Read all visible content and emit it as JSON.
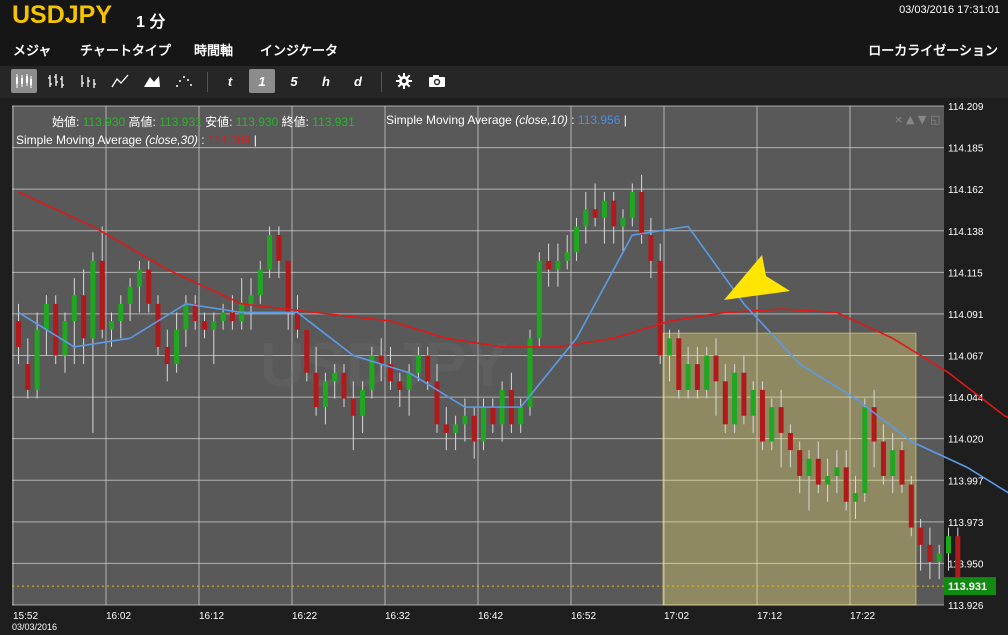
{
  "header": {
    "symbol": "USDJPY",
    "interval": "1 分",
    "datetime": "03/03/2016 17:31:01"
  },
  "menu": {
    "items": [
      "メジャ",
      "チャートタイプ",
      "時間軸",
      "インジケータ"
    ],
    "localization": "ローカライゼーション"
  },
  "toolbar": {
    "chart_types": [
      "candlestick-icon",
      "ohlc-bar-icon",
      "hlc-bar-icon",
      "line-icon",
      "mountain-icon",
      "dots-icon"
    ],
    "periods": [
      "t",
      "1",
      "5",
      "h",
      "d"
    ],
    "active_period": "1",
    "tools": [
      "gear-icon",
      "camera-icon"
    ]
  },
  "info": {
    "open_label": "始値:",
    "open": "113.930",
    "high_label": "高値:",
    "high": "113.931",
    "low_label": "安値:",
    "low": "113.930",
    "close_label": "終値:",
    "close": "113.931",
    "sma10_name": "Simple Moving Average",
    "sma10_params": "(close,10)",
    "sma10_value": "113.956",
    "sma30_name": "Simple Moving Average",
    "sma30_params": "(close,30)",
    "sma30_value": "114.009"
  },
  "colors": {
    "up": "#1fa81f",
    "down": "#b01a1a",
    "sma10": "#5b9be6",
    "sma30": "#e01818",
    "highlight": "#fff07a",
    "grid": "#cfcfcf",
    "background": "#595959",
    "arrow": "#ffe500"
  },
  "chart_data": {
    "type": "candlestick",
    "ylim": [
      113.92,
      114.21
    ],
    "y_ticks": [
      "114.209",
      "114.185",
      "114.162",
      "114.138",
      "114.115",
      "114.091",
      "114.067",
      "114.044",
      "114.020",
      "113.997",
      "113.973",
      "113.950",
      "113.926"
    ],
    "x_ticks": [
      "15:52",
      "16:02",
      "16:12",
      "16:22",
      "16:32",
      "16:42",
      "16:52",
      "17:02",
      "17:12",
      "17:22"
    ],
    "x_date": "03/03/2016",
    "last_price": "113.931",
    "start_time": "15:52",
    "candles": [
      [
        114.085,
        114.095,
        114.06,
        114.07
      ],
      [
        114.06,
        114.075,
        114.04,
        114.045
      ],
      [
        114.045,
        114.09,
        114.04,
        114.08
      ],
      [
        114.08,
        114.1,
        114.065,
        114.095
      ],
      [
        114.095,
        114.1,
        114.06,
        114.065
      ],
      [
        114.065,
        114.09,
        114.055,
        114.085
      ],
      [
        114.085,
        114.11,
        114.06,
        114.1
      ],
      [
        114.1,
        114.115,
        114.06,
        114.075
      ],
      [
        114.075,
        114.125,
        114.02,
        114.12
      ],
      [
        114.12,
        114.14,
        114.075,
        114.08
      ],
      [
        114.08,
        114.09,
        114.07,
        114.085
      ],
      [
        114.085,
        114.1,
        114.075,
        114.095
      ],
      [
        114.095,
        114.11,
        114.085,
        114.105
      ],
      [
        114.105,
        114.12,
        114.09,
        114.115
      ],
      [
        114.115,
        114.12,
        114.09,
        114.095
      ],
      [
        114.095,
        114.1,
        114.065,
        114.07
      ],
      [
        114.07,
        114.08,
        114.05,
        114.06
      ],
      [
        114.06,
        114.09,
        114.055,
        114.08
      ],
      [
        114.08,
        114.1,
        114.07,
        114.095
      ],
      [
        114.095,
        114.1,
        114.08,
        114.085
      ],
      [
        114.085,
        114.09,
        114.075,
        114.08
      ],
      [
        114.08,
        114.09,
        114.06,
        114.085
      ],
      [
        114.085,
        114.095,
        114.08,
        114.09
      ],
      [
        114.09,
        114.1,
        114.08,
        114.085
      ],
      [
        114.085,
        114.11,
        114.08,
        114.095
      ],
      [
        114.095,
        114.11,
        114.08,
        114.1
      ],
      [
        114.1,
        114.12,
        114.095,
        114.115
      ],
      [
        114.115,
        114.14,
        114.11,
        114.135
      ],
      [
        114.135,
        114.14,
        114.11,
        114.12
      ],
      [
        114.12,
        114.12,
        114.08,
        114.09
      ],
      [
        114.09,
        114.1,
        114.075,
        114.08
      ],
      [
        114.08,
        114.08,
        114.05,
        114.055
      ],
      [
        114.055,
        114.07,
        114.03,
        114.035
      ],
      [
        114.035,
        114.055,
        114.025,
        114.05
      ],
      [
        114.05,
        114.06,
        114.04,
        114.055
      ],
      [
        114.055,
        114.06,
        114.035,
        114.04
      ],
      [
        114.04,
        114.05,
        114.01,
        114.03
      ],
      [
        114.03,
        114.05,
        114.02,
        114.045
      ],
      [
        114.045,
        114.07,
        114.04,
        114.065
      ],
      [
        114.065,
        114.075,
        114.05,
        114.06
      ],
      [
        114.06,
        114.07,
        114.045,
        114.05
      ],
      [
        114.05,
        114.055,
        114.035,
        114.045
      ],
      [
        114.045,
        114.06,
        114.03,
        114.055
      ],
      [
        114.055,
        114.07,
        114.05,
        114.065
      ],
      [
        114.065,
        114.07,
        114.045,
        114.05
      ],
      [
        114.05,
        114.06,
        114.02,
        114.025
      ],
      [
        114.025,
        114.035,
        114.01,
        114.02
      ],
      [
        114.02,
        114.03,
        114.01,
        114.025
      ],
      [
        114.025,
        114.04,
        114.015,
        114.03
      ],
      [
        114.03,
        114.035,
        114.005,
        114.015
      ],
      [
        114.015,
        114.04,
        114.01,
        114.035
      ],
      [
        114.035,
        114.04,
        114.02,
        114.025
      ],
      [
        114.025,
        114.05,
        114.015,
        114.045
      ],
      [
        114.045,
        114.055,
        114.02,
        114.025
      ],
      [
        114.025,
        114.04,
        114.02,
        114.035
      ],
      [
        114.035,
        114.08,
        114.03,
        114.075
      ],
      [
        114.075,
        114.125,
        114.07,
        114.12
      ],
      [
        114.12,
        114.13,
        114.105,
        114.115
      ],
      [
        114.115,
        114.13,
        114.105,
        114.12
      ],
      [
        114.12,
        114.135,
        114.115,
        114.125
      ],
      [
        114.125,
        114.145,
        114.12,
        114.14
      ],
      [
        114.14,
        114.16,
        114.13,
        114.15
      ],
      [
        114.15,
        114.165,
        114.14,
        114.145
      ],
      [
        114.145,
        114.16,
        114.13,
        114.155
      ],
      [
        114.155,
        114.16,
        114.13,
        114.14
      ],
      [
        114.14,
        114.15,
        114.125,
        114.145
      ],
      [
        114.145,
        114.165,
        114.14,
        114.16
      ],
      [
        114.16,
        114.17,
        114.13,
        114.135
      ],
      [
        114.135,
        114.145,
        114.11,
        114.12
      ],
      [
        114.12,
        114.13,
        114.06,
        114.065
      ],
      [
        114.065,
        114.08,
        114.05,
        114.075
      ],
      [
        114.075,
        114.08,
        114.04,
        114.045
      ],
      [
        114.045,
        114.07,
        114.04,
        114.06
      ],
      [
        114.06,
        114.07,
        114.04,
        114.045
      ],
      [
        114.045,
        114.07,
        114.04,
        114.065
      ],
      [
        114.065,
        114.075,
        114.03,
        114.05
      ],
      [
        114.05,
        114.06,
        114.02,
        114.025
      ],
      [
        114.025,
        114.06,
        114.02,
        114.055
      ],
      [
        114.055,
        114.065,
        114.025,
        114.03
      ],
      [
        114.03,
        114.05,
        114.02,
        114.045
      ],
      [
        114.045,
        114.05,
        114.01,
        114.015
      ],
      [
        114.015,
        114.04,
        114.01,
        114.035
      ],
      [
        114.035,
        114.045,
        114.0,
        114.02
      ],
      [
        114.02,
        114.025,
        114.0,
        114.01
      ],
      [
        114.01,
        114.015,
        113.985,
        113.995
      ],
      [
        113.995,
        114.01,
        113.975,
        114.005
      ],
      [
        114.005,
        114.015,
        113.985,
        113.99
      ],
      [
        113.99,
        114.005,
        113.98,
        113.995
      ],
      [
        113.995,
        114.01,
        113.985,
        114.0
      ],
      [
        114.0,
        114.01,
        113.975,
        113.98
      ],
      [
        113.98,
        113.995,
        113.97,
        113.985
      ],
      [
        113.985,
        114.04,
        113.98,
        114.035
      ],
      [
        114.035,
        114.045,
        114.0,
        114.015
      ],
      [
        114.015,
        114.025,
        113.99,
        113.995
      ],
      [
        113.995,
        114.02,
        113.985,
        114.01
      ],
      [
        114.01,
        114.015,
        113.985,
        113.99
      ],
      [
        113.99,
        113.995,
        113.96,
        113.965
      ],
      [
        113.965,
        113.97,
        113.94,
        113.955
      ],
      [
        113.955,
        113.965,
        113.935,
        113.945
      ],
      [
        113.945,
        113.955,
        113.935,
        113.95
      ],
      [
        113.95,
        113.965,
        113.94,
        113.96
      ],
      [
        113.96,
        113.965,
        113.93,
        113.935
      ],
      [
        113.931,
        113.931,
        113.93,
        113.931
      ]
    ],
    "sma10": [
      [
        0,
        114.09
      ],
      [
        6,
        114.07
      ],
      [
        12,
        114.075
      ],
      [
        18,
        114.095
      ],
      [
        24,
        114.09
      ],
      [
        30,
        114.09
      ],
      [
        36,
        114.065
      ],
      [
        42,
        114.055
      ],
      [
        48,
        114.035
      ],
      [
        54,
        114.035
      ],
      [
        60,
        114.075
      ],
      [
        66,
        114.135
      ],
      [
        72,
        114.14
      ],
      [
        78,
        114.095
      ],
      [
        84,
        114.06
      ],
      [
        90,
        114.04
      ],
      [
        96,
        114.015
      ],
      [
        102,
        114.0
      ],
      [
        108,
        113.98
      ],
      [
        115,
        113.956
      ]
    ],
    "sma30": [
      [
        0,
        114.16
      ],
      [
        8,
        114.14
      ],
      [
        16,
        114.115
      ],
      [
        24,
        114.095
      ],
      [
        32,
        114.09
      ],
      [
        40,
        114.085
      ],
      [
        46,
        114.075
      ],
      [
        52,
        114.07
      ],
      [
        58,
        114.07
      ],
      [
        64,
        114.075
      ],
      [
        70,
        114.085
      ],
      [
        76,
        114.09
      ],
      [
        82,
        114.092
      ],
      [
        88,
        114.09
      ],
      [
        94,
        114.075
      ],
      [
        100,
        114.055
      ],
      [
        106,
        114.03
      ],
      [
        115,
        114.009
      ]
    ],
    "highlight_time_range": [
      "17:02",
      "17:31"
    ],
    "annotation": "arrow pointing down-left at SMA30 crossover"
  }
}
